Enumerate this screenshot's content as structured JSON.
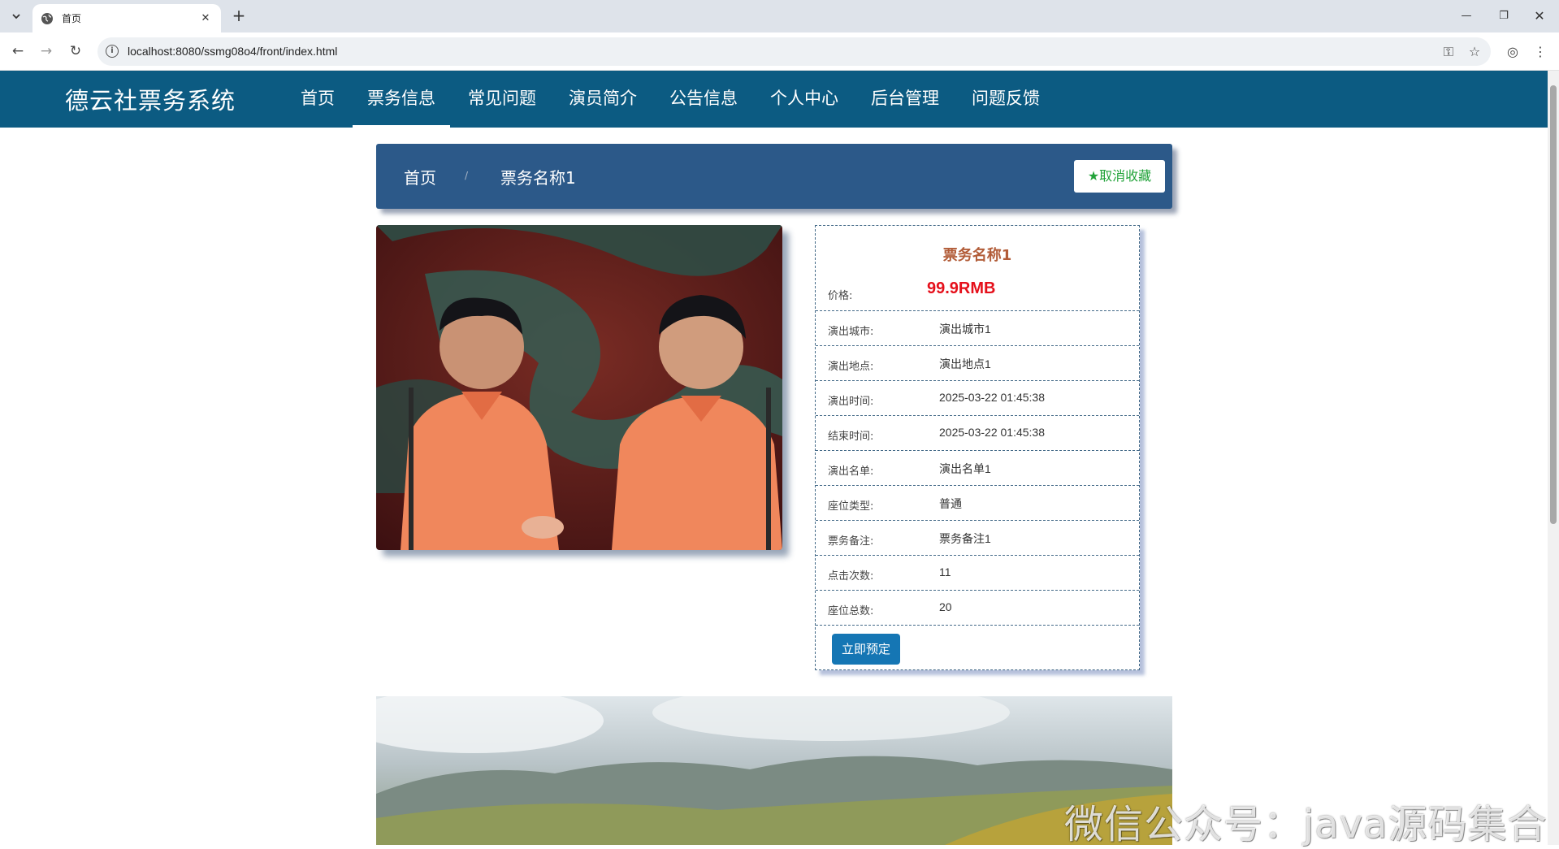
{
  "browser": {
    "tab_title": "首页",
    "url": "localhost:8080/ssmg08o4/front/index.html"
  },
  "site": {
    "brand": "德云社票务系统",
    "menu": [
      {
        "label": "首页",
        "active": false
      },
      {
        "label": "票务信息",
        "active": true
      },
      {
        "label": "常见问题",
        "active": false
      },
      {
        "label": "演员简介",
        "active": false
      },
      {
        "label": "公告信息",
        "active": false
      },
      {
        "label": "个人中心",
        "active": false
      },
      {
        "label": "后台管理",
        "active": false
      },
      {
        "label": "问题反馈",
        "active": false
      }
    ]
  },
  "breadcrumb": {
    "home": "首页",
    "separator": "/",
    "current": "票务名称1",
    "favorite_button": "取消收藏"
  },
  "detail": {
    "title": "票务名称1",
    "price_label": "价格:",
    "price_value": "99.9RMB",
    "rows": [
      {
        "label": "演出城市:",
        "value": "演出城市1"
      },
      {
        "label": "演出地点:",
        "value": "演出地点1"
      },
      {
        "label": "演出时间:",
        "value": "2025-03-22 01:45:38"
      },
      {
        "label": "结束时间:",
        "value": "2025-03-22 01:45:38"
      },
      {
        "label": "演出名单:",
        "value": "演出名单1"
      },
      {
        "label": "座位类型:",
        "value": "普通"
      },
      {
        "label": "票务备注:",
        "value": "票务备注1"
      },
      {
        "label": "点击次数:",
        "value": "11"
      },
      {
        "label": "座位总数:",
        "value": "20"
      }
    ],
    "book_button": "立即预定"
  },
  "watermark": "微信公众号：java源码集合",
  "colors": {
    "header_bg": "#0c5b82",
    "breadcrumb_bg": "#2c5989",
    "price": "#e5101b",
    "title": "#b25c38",
    "favorite": "#22a33a",
    "book_button": "#1576b4"
  }
}
